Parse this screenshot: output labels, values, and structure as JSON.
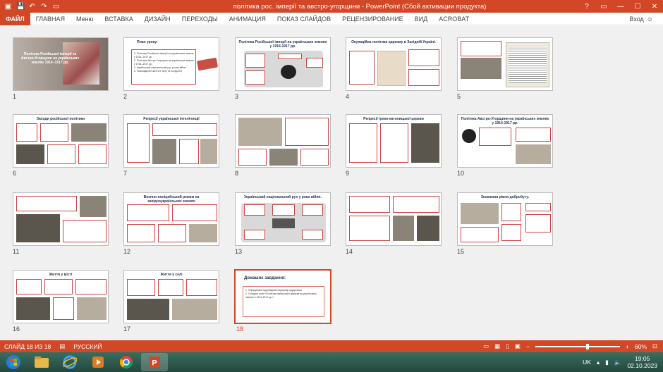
{
  "window": {
    "title": "політика рос. імперії та австро-угорщини  -  PowerPoint (Сбой активации продукта)",
    "qat_icons": [
      "save-icon",
      "undo-icon",
      "redo-icon",
      "slideshow-icon"
    ],
    "controls": [
      "?",
      "▭",
      "—",
      "☐",
      "✕"
    ]
  },
  "ribbon": {
    "file": "ФАЙЛ",
    "tabs": [
      "ГЛАВНАЯ",
      "Меню",
      "ВСТАВКА",
      "ДИЗАЙН",
      "ПЕРЕХОДЫ",
      "АНИМАЦИЯ",
      "ПОКАЗ СЛАЙДОВ",
      "РЕЦЕНЗИРОВАНИЕ",
      "ВИД",
      "ACROBAT"
    ],
    "login": "Вход"
  },
  "slides": [
    {
      "num": "1",
      "title": "Політика Російської імперії та Австро-Угорщини на українських землях 1914–1917 рр."
    },
    {
      "num": "2",
      "title": "План уроку:",
      "lines": [
        "1. Політика Російської імперії на українських землях у 1914–1917 рр.",
        "2. Політика Австро-Угорщини на українських землях у 1914–1917 рр.",
        "3. Український національний рух у роки війни.",
        "4. Повсякденне життя в тилу та на фронті"
      ]
    },
    {
      "num": "3",
      "title": "Політика Російської імперії на українських землях у 1914-1917 рр."
    },
    {
      "num": "4",
      "title": "Окупаційна політика царизму в Західній Україні."
    },
    {
      "num": "5",
      "title": ""
    },
    {
      "num": "6",
      "title": "Заходи російської політики"
    },
    {
      "num": "7",
      "title": "Репресії української інтелігенції"
    },
    {
      "num": "8",
      "title": ""
    },
    {
      "num": "9",
      "title": "Репресії греко-католицької церкви"
    },
    {
      "num": "10",
      "title": "Політика Австро-Угорщини на українських землях у 1914-1917 рр."
    },
    {
      "num": "11",
      "title": ""
    },
    {
      "num": "12",
      "title": "Воєнно-поліцейський режим на західноукраїнських землях"
    },
    {
      "num": "13",
      "title": "Український національний рух у роки війни."
    },
    {
      "num": "14",
      "title": ""
    },
    {
      "num": "15",
      "title": "Зниження рівня добробуту."
    },
    {
      "num": "16",
      "title": "Життя у місті"
    },
    {
      "num": "17",
      "title": "Життя у селі"
    },
    {
      "num": "18",
      "title": "Домашнє завдання:",
      "lines": [
        "1. Опрацювати відповідний параграф підручника.",
        "2. Складіть план «Політика імперських держав на українських землях в 1914-1917 рр.»"
      ]
    }
  ],
  "status": {
    "slide_info": "СЛАЙД 18 ИЗ 18",
    "language": "РУССКИЙ",
    "zoom": "60%"
  },
  "taskbar": {
    "apps": [
      "explorer-icon",
      "ie-icon",
      "media-icon",
      "chrome-icon",
      "powerpoint-icon"
    ],
    "lang": "UK",
    "time": "19:05",
    "date": "02.10.2023"
  },
  "colors": {
    "accent": "#d24726",
    "selected_border": "#d24726"
  }
}
